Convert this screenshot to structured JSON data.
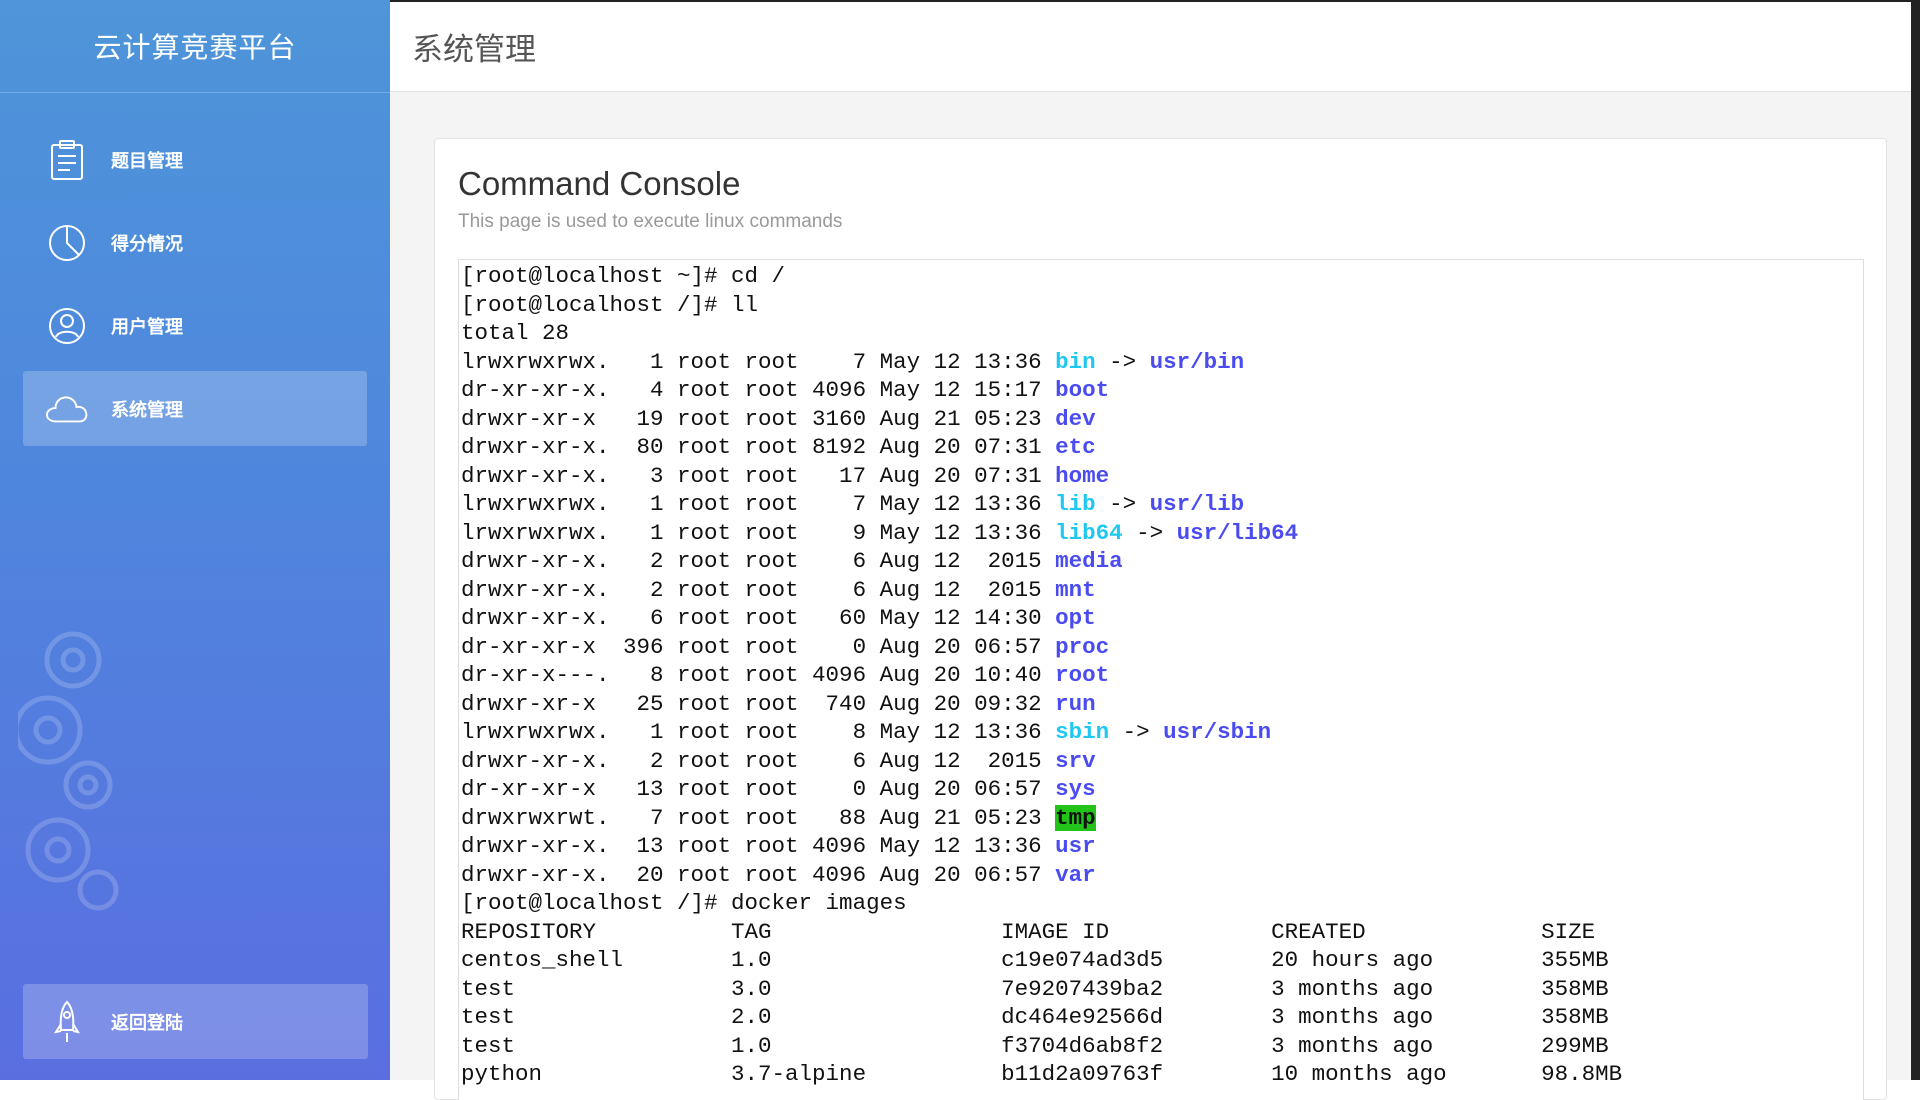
{
  "sidebar": {
    "brand": "云计算竞赛平台",
    "items": [
      {
        "label": "题目管理",
        "icon": "clipboard-icon",
        "active": false
      },
      {
        "label": "得分情况",
        "icon": "pie-chart-icon",
        "active": false
      },
      {
        "label": "用户管理",
        "icon": "user-icon",
        "active": false
      },
      {
        "label": "系统管理",
        "icon": "cloud-icon",
        "active": true
      }
    ],
    "logout_label": "返回登陆",
    "logout_icon": "rocket-icon"
  },
  "header": {
    "title": "系统管理"
  },
  "panel": {
    "title": "Command Console",
    "subtitle": "This page is used to execute linux commands"
  },
  "colors": {
    "sidebar_top": "#4e95d9",
    "sidebar_bottom": "#5a6ee0",
    "link_cyan": "#1ec8f0",
    "dir_blue": "#4a4bf0",
    "tmp_highlight": "#22c41a"
  },
  "console": {
    "lines": [
      {
        "text": "[root@localhost ~]# cd /"
      },
      {
        "text": "[root@localhost /]# ll"
      },
      {
        "text": "total 28"
      },
      {
        "perm": "lrwxrwxrwx.",
        "links": "1",
        "owner": "root",
        "group": "root",
        "size": "7",
        "date": "May 12 13:36",
        "name": "bin",
        "type": "link",
        "target": "usr/bin"
      },
      {
        "perm": "dr-xr-xr-x.",
        "links": "4",
        "owner": "root",
        "group": "root",
        "size": "4096",
        "date": "May 12 15:17",
        "name": "boot",
        "type": "dir"
      },
      {
        "perm": "drwxr-xr-x",
        "links": "19",
        "owner": "root",
        "group": "root",
        "size": "3160",
        "date": "Aug 21 05:23",
        "name": "dev",
        "type": "dir"
      },
      {
        "perm": "drwxr-xr-x.",
        "links": "80",
        "owner": "root",
        "group": "root",
        "size": "8192",
        "date": "Aug 20 07:31",
        "name": "etc",
        "type": "dir"
      },
      {
        "perm": "drwxr-xr-x.",
        "links": "3",
        "owner": "root",
        "group": "root",
        "size": "17",
        "date": "Aug 20 07:31",
        "name": "home",
        "type": "dir"
      },
      {
        "perm": "lrwxrwxrwx.",
        "links": "1",
        "owner": "root",
        "group": "root",
        "size": "7",
        "date": "May 12 13:36",
        "name": "lib",
        "type": "link",
        "target": "usr/lib"
      },
      {
        "perm": "lrwxrwxrwx.",
        "links": "1",
        "owner": "root",
        "group": "root",
        "size": "9",
        "date": "May 12 13:36",
        "name": "lib64",
        "type": "link",
        "target": "usr/lib64"
      },
      {
        "perm": "drwxr-xr-x.",
        "links": "2",
        "owner": "root",
        "group": "root",
        "size": "6",
        "date": "Aug 12  2015",
        "name": "media",
        "type": "dir"
      },
      {
        "perm": "drwxr-xr-x.",
        "links": "2",
        "owner": "root",
        "group": "root",
        "size": "6",
        "date": "Aug 12  2015",
        "name": "mnt",
        "type": "dir"
      },
      {
        "perm": "drwxr-xr-x.",
        "links": "6",
        "owner": "root",
        "group": "root",
        "size": "60",
        "date": "May 12 14:30",
        "name": "opt",
        "type": "dir"
      },
      {
        "perm": "dr-xr-xr-x",
        "links": "396",
        "owner": "root",
        "group": "root",
        "size": "0",
        "date": "Aug 20 06:57",
        "name": "proc",
        "type": "dir"
      },
      {
        "perm": "dr-xr-x---.",
        "links": "8",
        "owner": "root",
        "group": "root",
        "size": "4096",
        "date": "Aug 20 10:40",
        "name": "root",
        "type": "dir"
      },
      {
        "perm": "drwxr-xr-x",
        "links": "25",
        "owner": "root",
        "group": "root",
        "size": "740",
        "date": "Aug 20 09:32",
        "name": "run",
        "type": "dir"
      },
      {
        "perm": "lrwxrwxrwx.",
        "links": "1",
        "owner": "root",
        "group": "root",
        "size": "8",
        "date": "May 12 13:36",
        "name": "sbin",
        "type": "link",
        "target": "usr/sbin"
      },
      {
        "perm": "drwxr-xr-x.",
        "links": "2",
        "owner": "root",
        "group": "root",
        "size": "6",
        "date": "Aug 12  2015",
        "name": "srv",
        "type": "dir"
      },
      {
        "perm": "dr-xr-xr-x",
        "links": "13",
        "owner": "root",
        "group": "root",
        "size": "0",
        "date": "Aug 20 06:57",
        "name": "sys",
        "type": "dir"
      },
      {
        "perm": "drwxrwxrwt.",
        "links": "7",
        "owner": "root",
        "group": "root",
        "size": "88",
        "date": "Aug 21 05:23",
        "name": "tmp",
        "type": "tmp"
      },
      {
        "perm": "drwxr-xr-x.",
        "links": "13",
        "owner": "root",
        "group": "root",
        "size": "4096",
        "date": "May 12 13:36",
        "name": "usr",
        "type": "dir"
      },
      {
        "perm": "drwxr-xr-x.",
        "links": "20",
        "owner": "root",
        "group": "root",
        "size": "4096",
        "date": "Aug 20 06:57",
        "name": "var",
        "type": "dir"
      },
      {
        "text": "[root@localhost /]# docker images"
      }
    ],
    "docker": {
      "columns": [
        "REPOSITORY",
        "TAG",
        "IMAGE ID",
        "CREATED",
        "SIZE"
      ],
      "rows": [
        [
          "centos_shell",
          "1.0",
          "c19e074ad3d5",
          "20 hours ago",
          "355MB"
        ],
        [
          "test",
          "3.0",
          "7e9207439ba2",
          "3 months ago",
          "358MB"
        ],
        [
          "test",
          "2.0",
          "dc464e92566d",
          "3 months ago",
          "358MB"
        ],
        [
          "test",
          "1.0",
          "f3704d6ab8f2",
          "3 months ago",
          "299MB"
        ],
        [
          "python",
          "3.7-alpine",
          "b11d2a09763f",
          "10 months ago",
          "98.8MB"
        ]
      ]
    }
  }
}
